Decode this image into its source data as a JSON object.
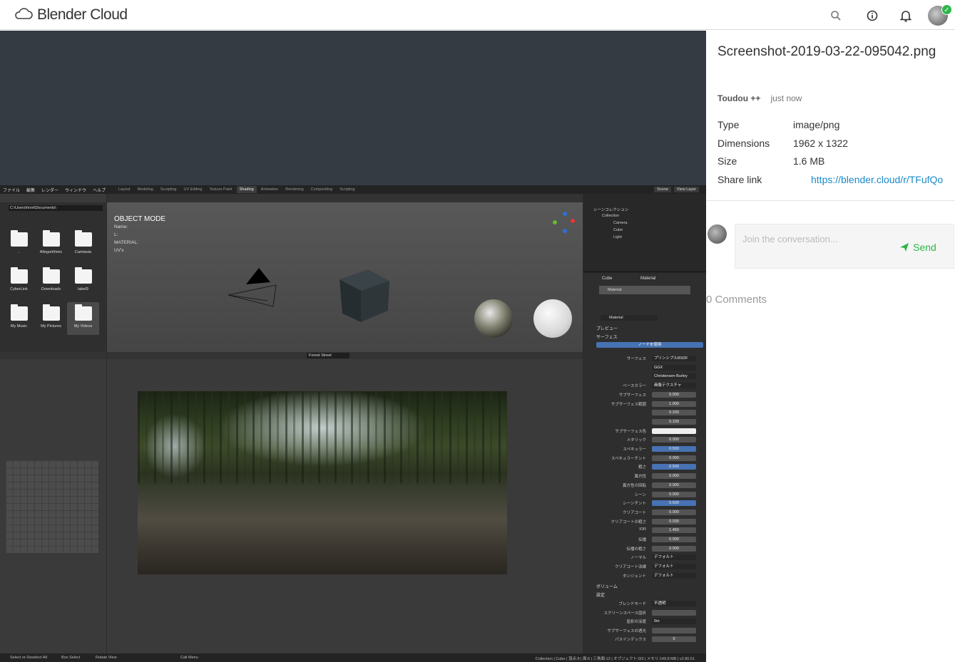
{
  "header": {
    "app_name": "Blender Cloud",
    "icons": [
      "cloud-icon",
      "search-icon",
      "info-icon",
      "bell-icon",
      "avatar"
    ],
    "accent": "#2fb54a"
  },
  "file": {
    "title": "Screenshot-2019-03-22-095042.png",
    "author": "Toudou ++",
    "time": "just now",
    "meta": [
      {
        "key": "Type",
        "value": "image/png"
      },
      {
        "key": "Dimensions",
        "value": "1962 x 1322"
      },
      {
        "key": "Size",
        "value": "1.6 MB"
      }
    ],
    "share_label": "Share link",
    "share_url": "https://blender.cloud/r/TFufQo"
  },
  "comments": {
    "placeholder": "Join the conversation...",
    "send_label": "Send",
    "count_label": "0 Comments"
  },
  "blender": {
    "menu": [
      "ファイル",
      "編集",
      "レンダー",
      "ウィンドウ",
      "ヘルプ"
    ],
    "tabs": [
      "Layout",
      "Modeling",
      "Sculpting",
      "UV Editing",
      "Texture Paint",
      "Shading",
      "Animation",
      "Rendering",
      "Compositing",
      "Scripting"
    ],
    "active_tab": "Shading",
    "scene": "Scene",
    "view_layer": "View Layer",
    "path": "C:\\Users\\front\\Documents\\",
    "folders": [
      "..",
      "Allegorithmic",
      "Camtasia",
      "CyberLink",
      "Downloads",
      "label9",
      "My Music",
      "My Pictures",
      "My Videos"
    ],
    "mode_title": "OBJECT MODE",
    "mode_lines": [
      "Name:",
      "L:",
      "MATERIAL:",
      "UV's"
    ],
    "outliner": [
      "シーンコレクション",
      "Collection",
      "Camera",
      "Cube",
      "Light"
    ],
    "props_tabs": [
      "Cube",
      "Material"
    ],
    "material_slot": "Material",
    "material_name": "Material",
    "sections": [
      "プレビュー",
      "サーフェス",
      "ボリューム",
      "設定"
    ],
    "use_nodes": "ノードを使用",
    "surface_rows": [
      {
        "label": "サーフェス",
        "value": "プリンシプルBSDF"
      },
      {
        "label": "",
        "value": "GGX"
      },
      {
        "label": "",
        "value": "Christensen-Burley"
      },
      {
        "label": "ベースカラー",
        "value": "画像テクスチャ"
      },
      {
        "label": "サブサーフェス",
        "value": "0.000"
      },
      {
        "label": "サブサーフェス範囲",
        "value": "1.000"
      },
      {
        "label": "",
        "value": "0.200"
      },
      {
        "label": "",
        "value": "0.100"
      },
      {
        "label": "サブサーフェス色",
        "value": ""
      },
      {
        "label": "メタリック",
        "value": "0.000"
      },
      {
        "label": "スペキュラー",
        "value": "0.500"
      },
      {
        "label": "スペキュラーチント",
        "value": "0.000"
      },
      {
        "label": "粗さ",
        "value": "0.500"
      },
      {
        "label": "異方性",
        "value": "0.000"
      },
      {
        "label": "異方性の回転",
        "value": "0.000"
      },
      {
        "label": "シーン",
        "value": "0.000"
      },
      {
        "label": "シーンチント",
        "value": "0.500"
      },
      {
        "label": "クリアコート",
        "value": "0.000"
      },
      {
        "label": "クリアコートの粗さ",
        "value": "0.030"
      },
      {
        "label": "IOR",
        "value": "1.450"
      },
      {
        "label": "伝播",
        "value": "0.000"
      },
      {
        "label": "伝播の粗さ",
        "value": "0.000"
      },
      {
        "label": "ノーマル",
        "value": "デフォルト"
      },
      {
        "label": "クリアコート法線",
        "value": "デフォルト"
      },
      {
        "label": "タンジェント",
        "value": "デフォルト"
      }
    ],
    "settings_rows": [
      {
        "label": "ブレンドモード",
        "value": "不透明"
      },
      {
        "label": "スクリーンスペース屈折",
        "value": ""
      },
      {
        "label": "屈折の深度",
        "value": "0m"
      },
      {
        "label": "サブサーフェスの透光",
        "value": ""
      },
      {
        "label": "パスインデックス",
        "value": "0"
      }
    ],
    "image_name": "Forest Street",
    "status_left": [
      "Select or Deselect All",
      "Box Select",
      "Rotate View",
      "Call Menu"
    ],
    "status_right": "Collection | Cube | 頂点:8 | 面:6 | 三角面:12 | オブジェクト:0/3 | メモリ:149.8 MB | v2.80.51"
  }
}
